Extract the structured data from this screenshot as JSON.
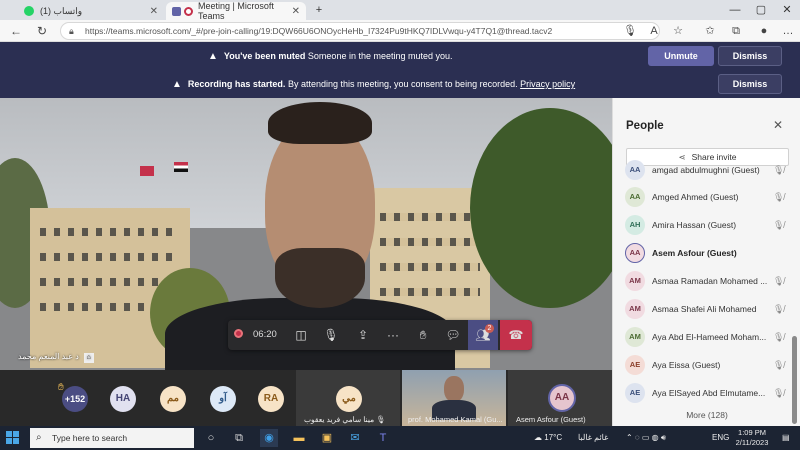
{
  "browser": {
    "tabs": [
      {
        "title": "(1) واتساب",
        "icon": "whatsapp-icon",
        "color": "#25d366",
        "active": false
      },
      {
        "title": "Meeting | Microsoft Teams",
        "icon": "teams-icon",
        "color": "#c4314b",
        "active": true
      }
    ],
    "new_tab": "+",
    "url": "https://teams.microsoft.com/_#/pre-join-calling/19:DQW66U6ONOycHeHb_I7324Pu9tHKQ7IDLVwqu-y4T7Q1@thread.tacv2"
  },
  "banners": {
    "muted": {
      "bold": "You've been muted",
      "text": "Someone in the meeting muted you.",
      "unmute_label": "Unmute",
      "dismiss_label": "Dismiss"
    },
    "recording": {
      "bold": "Recording has started.",
      "text": "By attending this meeting, you consent to being recorded.",
      "link": "Privacy policy",
      "dismiss_label": "Dismiss"
    }
  },
  "call": {
    "timer": "06:20",
    "people_badge": "2",
    "speaker_name": "د عبد المنعم محمد"
  },
  "gallery": {
    "overflow_count": "+152",
    "avatars": [
      {
        "initials": "HA",
        "bg": "#e1e1f0",
        "fg": "#454575"
      },
      {
        "initials": "مم",
        "bg": "#f7e3c6",
        "fg": "#8a5a1a"
      },
      {
        "initials": "آو",
        "bg": "#dde9f7",
        "fg": "#305a8a"
      },
      {
        "initials": "RA",
        "bg": "#f7e3c6",
        "fg": "#8a5a1a"
      }
    ],
    "tiles": [
      {
        "initials": "مي",
        "label": "مينا سامي فريد يعقوب",
        "bg": "#f7e3c6",
        "fg": "#8a5a1a"
      },
      {
        "initials": "",
        "label": "prof. Mohamed Kamal (Gu..."
      },
      {
        "initials": "AA",
        "label": "Asem Asfour (Guest)",
        "bg": "#e6c5ce",
        "fg": "#7a3447"
      }
    ]
  },
  "people_panel": {
    "title": "People",
    "share_label": "Share invite",
    "participants": [
      {
        "initials": "AA",
        "name": "amgad abdulmughni (Guest)",
        "bg": "#dde3ef",
        "fg": "#3b4f7a",
        "active": false
      },
      {
        "initials": "AA",
        "name": "Amged Ahmed (Guest)",
        "bg": "#dfe8d6",
        "fg": "#4a6b30",
        "active": false
      },
      {
        "initials": "AH",
        "name": "Amira Hassan (Guest)",
        "bg": "#d4ebe3",
        "fg": "#2f6e57",
        "active": false
      },
      {
        "initials": "AA",
        "name": "Asem Asfour (Guest)",
        "bg": "#f1dbe1",
        "fg": "#7a3447",
        "active": true
      },
      {
        "initials": "AM",
        "name": "Asmaa Ramadan Mohamed ...",
        "bg": "#f1dbe1",
        "fg": "#7a3447",
        "active": false
      },
      {
        "initials": "AM",
        "name": "Asmaa Shafei Ali Mohamed",
        "bg": "#f1dbe1",
        "fg": "#7a3447",
        "active": false
      },
      {
        "initials": "AM",
        "name": "Aya Abd El-Hameed Moham...",
        "bg": "#dfe8d6",
        "fg": "#4a6b30",
        "active": false
      },
      {
        "initials": "AE",
        "name": "Aya Eissa (Guest)",
        "bg": "#f4dcd6",
        "fg": "#8a3e2a",
        "active": false
      },
      {
        "initials": "AE",
        "name": "Aya ElSayed Abd Elmutame...",
        "bg": "#dde3ef",
        "fg": "#3b4f7a",
        "active": false
      }
    ],
    "more_label": "More (128)"
  },
  "taskbar": {
    "search_placeholder": "Type here to search",
    "weather": "17°C",
    "weather_text": "غائم غالبا",
    "language": "ENG",
    "time": "1:09 PM",
    "date": "2/11/2023"
  }
}
